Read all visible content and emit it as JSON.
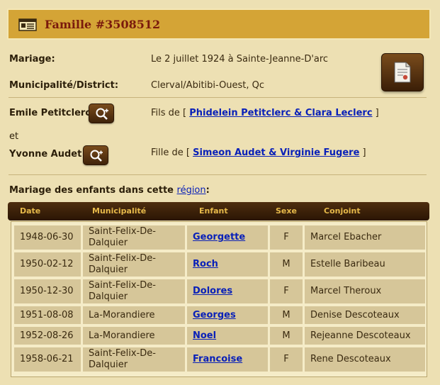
{
  "header": {
    "title": "Famille #3508512"
  },
  "details": {
    "mariage_label": "Mariage:",
    "mariage_value": "Le 2 juillet 1924 à Sainte-Jeanne-D'arc",
    "municipalite_label": "Municipalité/District:",
    "municipalite_value": "Clerval/Abitibi-Ouest, Qc"
  },
  "spouse1": {
    "name": "Emile Petitclerc",
    "relation_prefix": "Fils de [",
    "parents": "Phidelein Petitclerc & Clara Leclerc",
    "relation_suffix": "]"
  },
  "conjunction": "et",
  "spouse2": {
    "name": "Yvonne Audet",
    "relation_prefix": "Fille de [",
    "parents": "Simeon Audet & Virginie Fugere",
    "relation_suffix": "]"
  },
  "children_section": {
    "intro": "Mariage des enfants dans cette",
    "link": "région",
    "colon": ":"
  },
  "table": {
    "headers": [
      "Date",
      "Municipalité",
      "Enfant",
      "Sexe",
      "Conjoint"
    ],
    "rows": [
      {
        "date": "1948-06-30",
        "muni": "Saint-Felix-De-\nDalquier",
        "enfant": "Georgette",
        "sexe": "F",
        "conjoint": "Marcel Ebacher"
      },
      {
        "date": "1950-02-12",
        "muni": "Saint-Felix-De-\nDalquier",
        "enfant": "Roch",
        "sexe": "M",
        "conjoint": "Estelle Baribeau"
      },
      {
        "date": "1950-12-30",
        "muni": "Saint-Felix-De-\nDalquier",
        "enfant": "Dolores",
        "sexe": "F",
        "conjoint": "Marcel Theroux"
      },
      {
        "date": "1951-08-08",
        "muni": "La-Morandiere",
        "enfant": "Georges",
        "sexe": "M",
        "conjoint": "Denise Descoteaux"
      },
      {
        "date": "1952-08-26",
        "muni": "La-Morandiere",
        "enfant": "Noel",
        "sexe": "M",
        "conjoint": "Rejeanne Descoteaux"
      },
      {
        "date": "1958-06-21",
        "muni": "Saint-Felix-De-\nDalquier",
        "enfant": "Francoise",
        "sexe": "F",
        "conjoint": "Rene Descoteaux"
      }
    ]
  },
  "icons": {
    "header": "family-record-icon",
    "document": "document-icon",
    "search_add": "search-add-icon"
  },
  "colors": {
    "background": "#ede0b3",
    "header_bg": "#d4a436",
    "title": "#7a1a0c",
    "link": "#0a21b8",
    "table_header_bg": "#2a1504",
    "table_header_text": "#e6b94a",
    "cell_bg": "#d6c699"
  }
}
